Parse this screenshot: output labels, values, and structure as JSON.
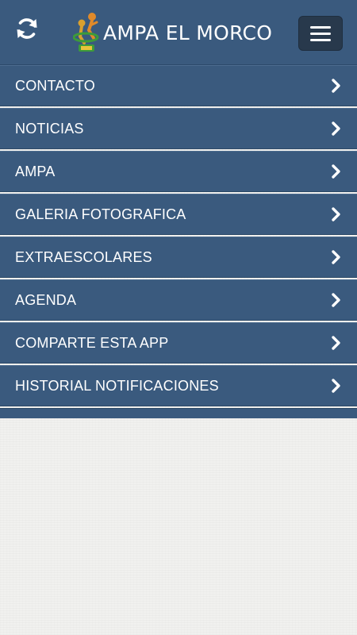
{
  "header": {
    "title": "AMPA EL MORCO",
    "refresh_icon": "refresh-icon",
    "menu_icon": "hamburger-menu-icon",
    "colors": {
      "bar": "#3a5a7e",
      "menu_button": "#28394c",
      "text": "#ffffff"
    }
  },
  "menu": {
    "items": [
      {
        "label": "CONTACTO"
      },
      {
        "label": "NOTICIAS"
      },
      {
        "label": "AMPA"
      },
      {
        "label": "GALERIA FOTOGRAFICA"
      },
      {
        "label": "EXTRAESCOLARES"
      },
      {
        "label": "AGENDA"
      },
      {
        "label": "COMPARTE ESTA APP"
      },
      {
        "label": "HISTORIAL NOTIFICACIONES"
      }
    ],
    "item_icon": "chevron-right-icon"
  }
}
